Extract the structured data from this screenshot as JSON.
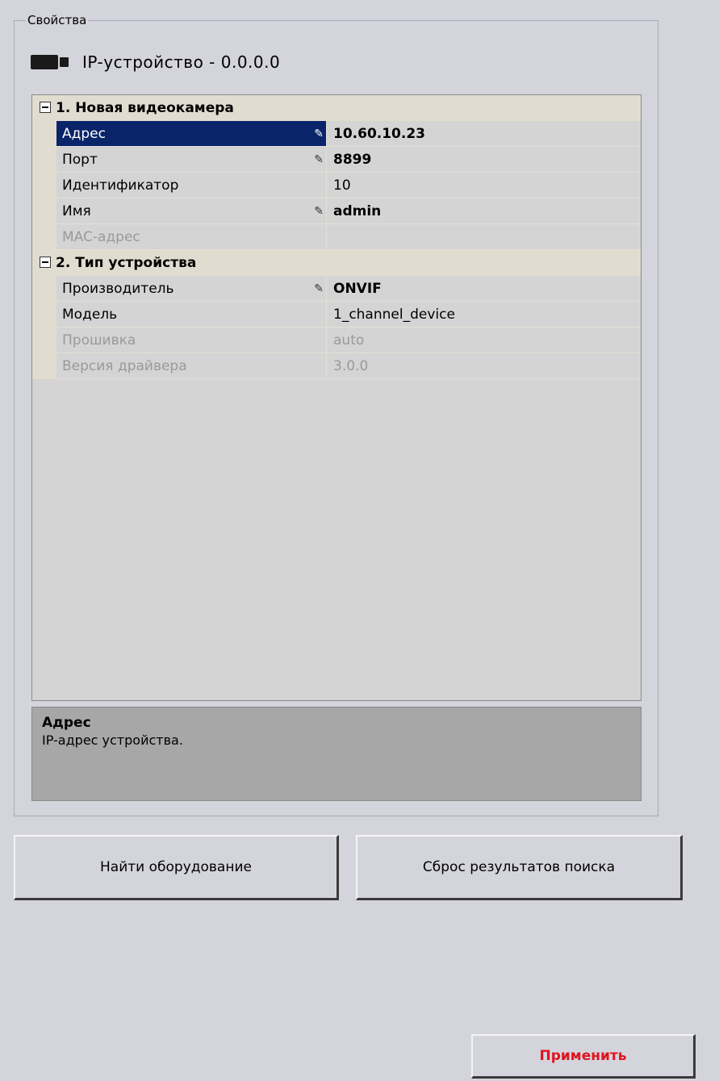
{
  "groupbox": {
    "title": "Свойства"
  },
  "device": {
    "icon": "video-camera-icon",
    "title": "IP-устройство - 0.0.0.0"
  },
  "grid": {
    "categories": [
      {
        "label": "1. Новая видеокамера",
        "expanded": true,
        "properties": [
          {
            "name": "Адрес",
            "value": "10.60.10.23",
            "editable": true,
            "selected": true
          },
          {
            "name": "Порт",
            "value": "8899",
            "editable": true
          },
          {
            "name": "Идентификатор",
            "value": "10",
            "editable": false
          },
          {
            "name": "Имя",
            "value": "admin",
            "editable": true
          },
          {
            "name": "MAC-адрес",
            "value": "",
            "editable": false,
            "disabled": true
          }
        ]
      },
      {
        "label": "2. Тип устройства",
        "expanded": true,
        "properties": [
          {
            "name": "Производитель",
            "value": "ONVIF",
            "editable": true
          },
          {
            "name": "Модель",
            "value": "1_channel_device",
            "editable": false
          },
          {
            "name": "Прошивка",
            "value": "auto",
            "editable": false,
            "disabled": true
          },
          {
            "name": "Версия драйвера",
            "value": "3.0.0",
            "editable": false,
            "disabled": true
          }
        ]
      }
    ]
  },
  "help": {
    "title": "Адрес",
    "description": "IP-адрес устройства."
  },
  "buttons": {
    "find": "Найти оборудование",
    "reset": "Сброс результатов поиска",
    "apply": "Применить"
  },
  "colors": {
    "selection": "#0a246a",
    "apply_text": "#e0141e",
    "category_bg": "#e0dcd0"
  }
}
